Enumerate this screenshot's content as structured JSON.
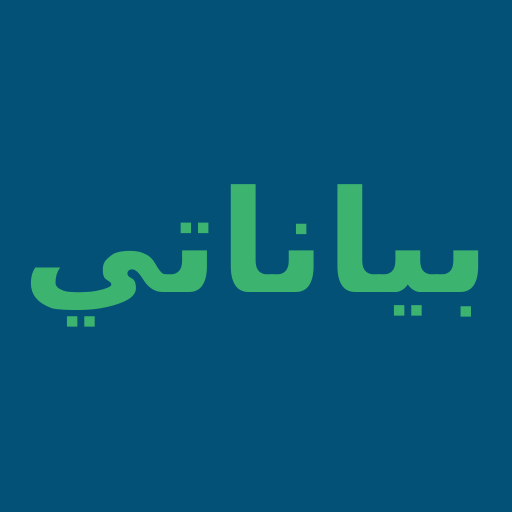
{
  "app_icon": {
    "wordmark": "بياناتي",
    "background_color": "#035176",
    "text_color": "#3DB370"
  }
}
